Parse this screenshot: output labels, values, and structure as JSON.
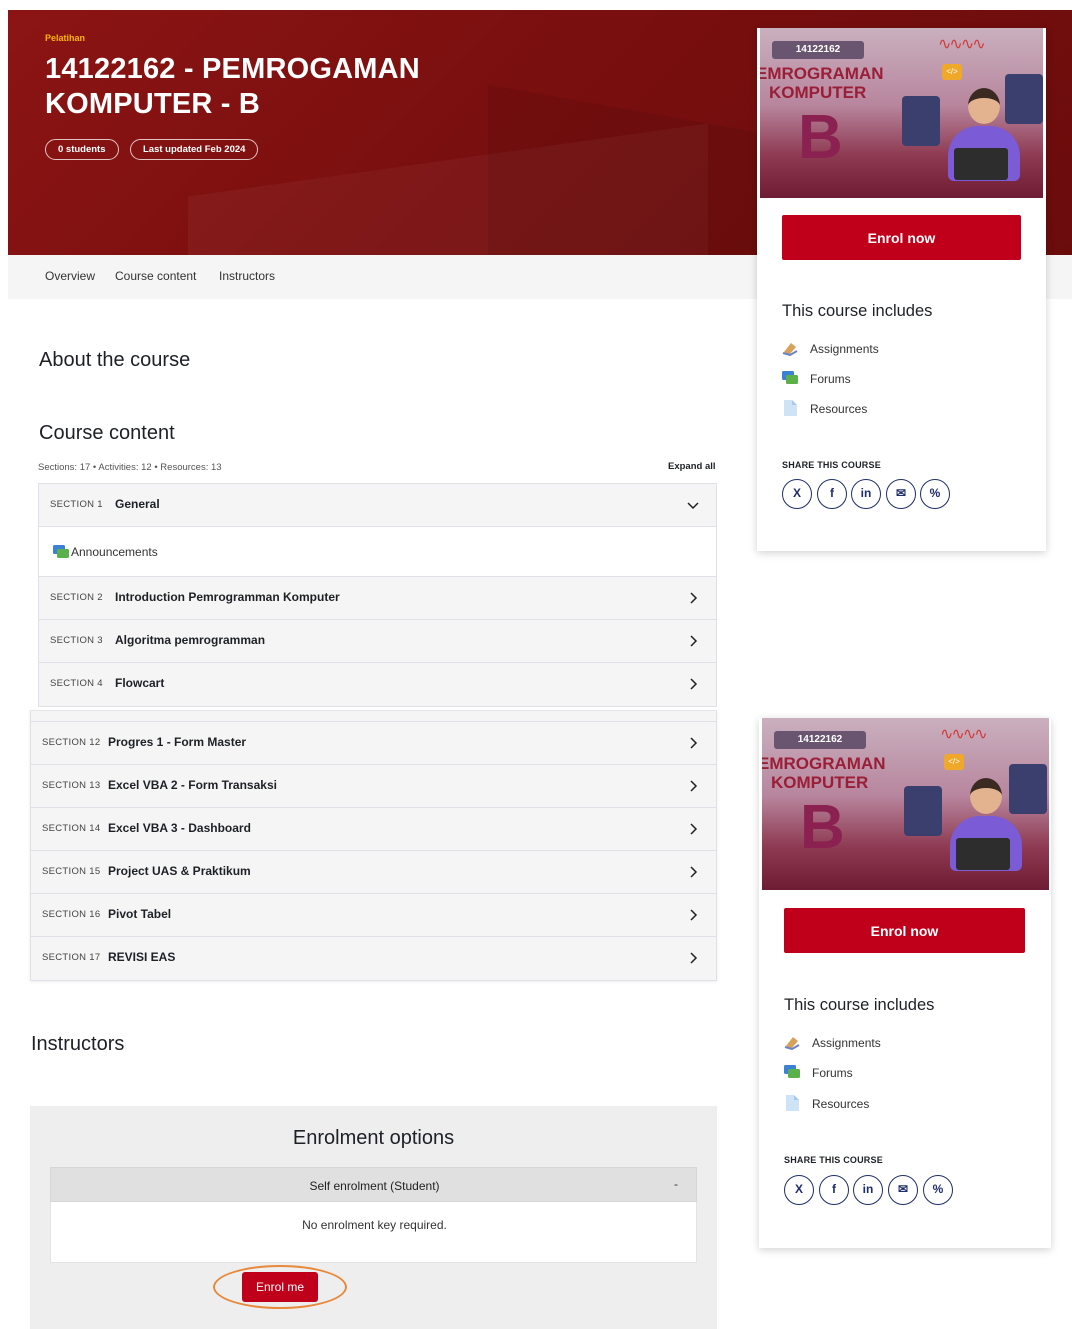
{
  "hero": {
    "tag": "Pelatihan",
    "title": "14122162 - PEMROGAMAN KOMPUTER - B",
    "students": "0 students",
    "updated": "Last updated Feb 2024"
  },
  "nav": {
    "tabs": [
      "Overview",
      "Course content",
      "Instructors"
    ]
  },
  "main": {
    "about_heading": "About the course",
    "content_heading": "Course content",
    "meta": "Sections: 17 • Activities: 12 • Resources: 13",
    "expand_all": "Expand all",
    "sections_top": [
      {
        "num": "SECTION 1",
        "title": "General",
        "expanded": true
      },
      {
        "num": "SECTION 2",
        "title": "Introduction Pemrogramman Komputer"
      },
      {
        "num": "SECTION 3",
        "title": "Algoritma pemrogramman"
      },
      {
        "num": "SECTION 4",
        "title": "Flowcart"
      }
    ],
    "activity": {
      "label": "Announcements",
      "icon": "forum-icon"
    },
    "sections_bottom": [
      {
        "num": "SECTION 12",
        "title": "Progres 1 - Form Master"
      },
      {
        "num": "SECTION 13",
        "title": "Excel VBA 2 - Form Transaksi"
      },
      {
        "num": "SECTION 14",
        "title": "Excel VBA 3 - Dashboard"
      },
      {
        "num": "SECTION 15",
        "title": "Project UAS & Praktikum"
      },
      {
        "num": "SECTION 16",
        "title": "Pivot Tabel"
      },
      {
        "num": "SECTION 17",
        "title": "REVISI EAS"
      }
    ],
    "instructors_heading": "Instructors"
  },
  "enrolment": {
    "title": "Enrolment options",
    "method": "Self enrolment (Student)",
    "toggle": "-",
    "note": "No enrolment key required.",
    "button": "Enrol me"
  },
  "sidebar": {
    "thumb_code": "14122162",
    "thumb_line1": "EMROGRAMAN",
    "thumb_line2": "KOMPUTER",
    "thumb_letter": "B",
    "thumb_tag": "</>",
    "enrol_now": "Enrol now",
    "includes_title": "This course includes",
    "includes": [
      {
        "label": "Assignments",
        "icon": "assignment-icon"
      },
      {
        "label": "Forums",
        "icon": "forum-icon"
      },
      {
        "label": "Resources",
        "icon": "file-icon"
      }
    ],
    "share_title": "SHARE THIS COURSE",
    "socials": [
      {
        "icon": "x-icon",
        "glyph": "X"
      },
      {
        "icon": "facebook-icon",
        "glyph": "f"
      },
      {
        "icon": "linkedin-icon",
        "glyph": "in"
      },
      {
        "icon": "email-icon",
        "glyph": "✉"
      },
      {
        "icon": "link-icon",
        "glyph": "%"
      }
    ]
  },
  "colors": {
    "hero": "#7a0f0f",
    "accent": "#c0001a",
    "tag": "#f7b500",
    "highlight": "#e8883a"
  }
}
